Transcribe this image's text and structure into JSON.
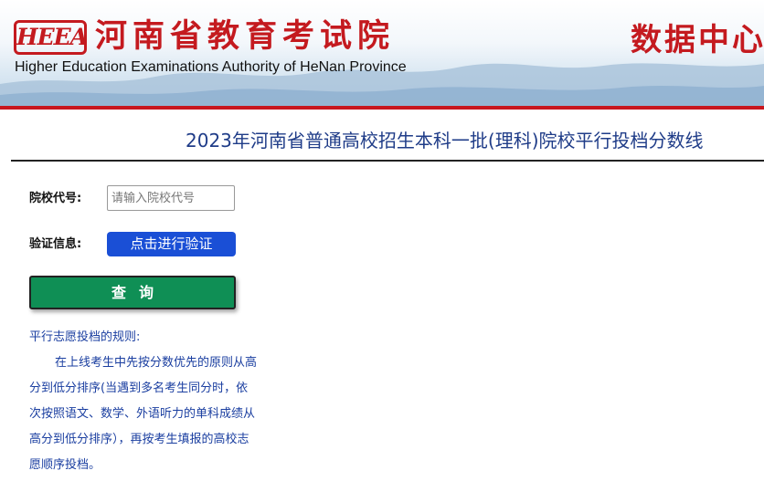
{
  "header": {
    "logo_text": "HEEA",
    "org_name_cn": "河南省教育考试院",
    "org_name_en": "Higher Education Examinations Authority of HeNan Province",
    "section_title": "数据中心",
    "accent_color": "#c41a1f"
  },
  "page": {
    "title": "2023年河南省普通高校招生本科一批(理科)院校平行投档分数线"
  },
  "form": {
    "code_label": "院校代号:",
    "code_placeholder": "请输入院校代号",
    "code_value": "",
    "verify_label": "验证信息:",
    "verify_button": "点击进行验证",
    "query_button": "查询"
  },
  "rules": {
    "heading": "平行志愿投档的规则:",
    "body": "在上线考生中先按分数优先的原则从高分到低分排序(当遇到多名考生同分时，依次按照语文、数学、外语听力的单科成绩从高分到低分排序），再按考生填报的高校志愿顺序投档。"
  }
}
